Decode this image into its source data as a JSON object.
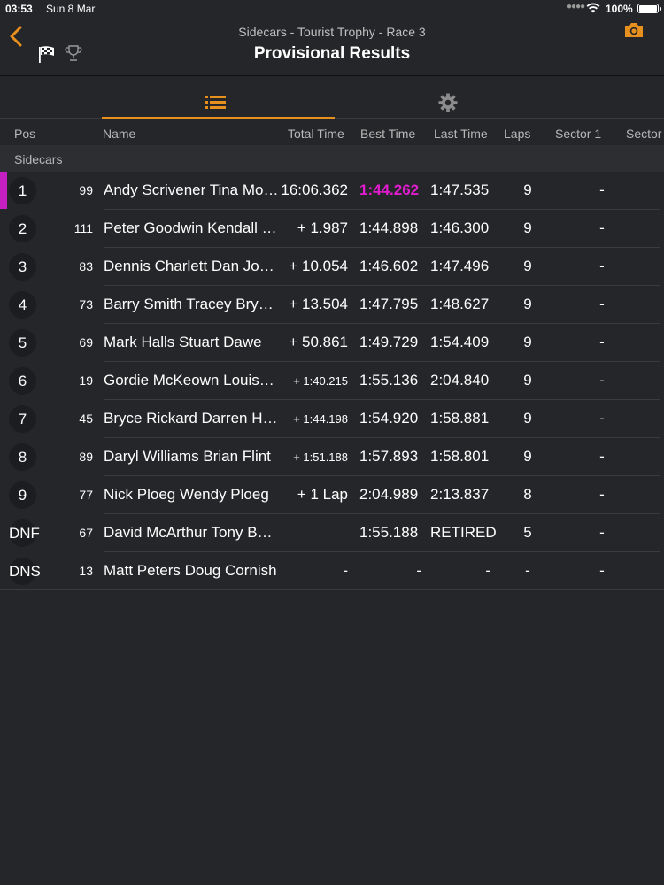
{
  "status_bar": {
    "time": "03:53",
    "date": "Sun 8 Mar",
    "battery": "100%"
  },
  "nav": {
    "subtitle": "Sidecars - Tourist Trophy - Race 3",
    "title": "Provisional Results"
  },
  "columns": {
    "pos": "Pos",
    "name": "Name",
    "total_time": "Total Time",
    "best_time": "Best Time",
    "last_time": "Last Time",
    "laps": "Laps",
    "sector1": "Sector 1",
    "sector2": "Sector"
  },
  "group": "Sidecars",
  "colors": {
    "accent": "#e8901e",
    "fastest_lap": "#e01ccf",
    "leader_marker": "#c41fc0",
    "background": "#252629"
  },
  "rows": [
    {
      "pos": "1",
      "num": "99",
      "name": "Andy Scrivener Tina Morris",
      "total": "16:06.362",
      "best": "1:44.262",
      "last": "1:47.535",
      "laps": "9",
      "s1": "-"
    },
    {
      "pos": "2",
      "num": "111",
      "name": "Peter Goodwin Kendall Kirk",
      "total": "+ 1.987",
      "best": "1:44.898",
      "last": "1:46.300",
      "laps": "9",
      "s1": "-"
    },
    {
      "pos": "3",
      "num": "83",
      "name": "Dennis Charlett Dan Jones",
      "total": "+ 10.054",
      "best": "1:46.602",
      "last": "1:47.496",
      "laps": "9",
      "s1": "-"
    },
    {
      "pos": "4",
      "num": "73",
      "name": "Barry Smith Tracey Bryant",
      "total": "+ 13.504",
      "best": "1:47.795",
      "last": "1:48.627",
      "laps": "9",
      "s1": "-"
    },
    {
      "pos": "5",
      "num": "69",
      "name": "Mark Halls Stuart Dawe",
      "total": "+ 50.861",
      "best": "1:49.729",
      "last": "1:54.409",
      "laps": "9",
      "s1": "-"
    },
    {
      "pos": "6",
      "num": "19",
      "name": "Gordie McKeown Louise Cole",
      "total": "+ 1:40.215",
      "best": "1:55.136",
      "last": "2:04.840",
      "laps": "9",
      "s1": "-"
    },
    {
      "pos": "7",
      "num": "45",
      "name": "Bryce Rickard Darren Hope",
      "total": "+ 1:44.198",
      "best": "1:54.920",
      "last": "1:58.881",
      "laps": "9",
      "s1": "-"
    },
    {
      "pos": "8",
      "num": "89",
      "name": "Daryl Williams Brian Flint",
      "total": "+ 1:51.188",
      "best": "1:57.893",
      "last": "1:58.801",
      "laps": "9",
      "s1": "-"
    },
    {
      "pos": "9",
      "num": "77",
      "name": "Nick Ploeg Wendy  Ploeg",
      "total": "+ 1 Lap",
      "best": "2:04.989",
      "last": "2:13.837",
      "laps": "8",
      "s1": "-"
    },
    {
      "pos": "DNF",
      "num": "67",
      "name": "David McArthur Tony Baker",
      "total": "",
      "best": "1:55.188",
      "last": "RETIRED",
      "laps": "5",
      "s1": "-"
    },
    {
      "pos": "DNS",
      "num": "13",
      "name": "Matt Peters Doug Cornish",
      "total": "-",
      "best": "-",
      "last": "-",
      "laps": "-",
      "s1": "-"
    }
  ]
}
